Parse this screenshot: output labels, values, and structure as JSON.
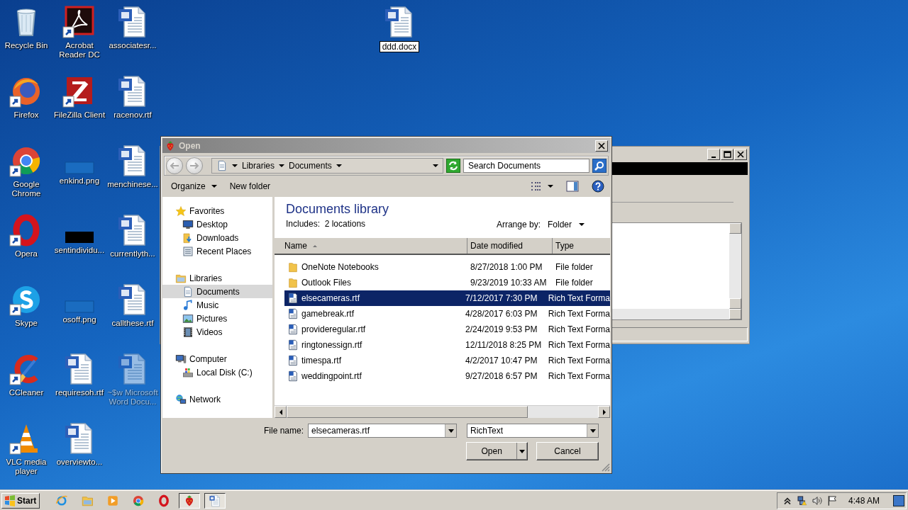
{
  "desktop": {
    "icons": [
      {
        "label": "Recycle Bin",
        "kind": "recycle",
        "shortcut": false
      },
      {
        "label": "Firefox",
        "kind": "firefox",
        "shortcut": true
      },
      {
        "label": "Google Chrome",
        "kind": "chrome",
        "shortcut": true
      },
      {
        "label": "Opera",
        "kind": "opera",
        "shortcut": true
      },
      {
        "label": "Skype",
        "kind": "skype",
        "shortcut": true
      },
      {
        "label": "CCleaner",
        "kind": "ccleaner",
        "shortcut": true
      },
      {
        "label": "VLC media player",
        "kind": "vlc",
        "shortcut": true
      },
      {
        "label": "Acrobat Reader DC",
        "kind": "acrobat",
        "shortcut": true
      },
      {
        "label": "FileZilla Client",
        "kind": "filezilla",
        "shortcut": true
      },
      {
        "label": "enkind.png",
        "kind": "image-blank",
        "shortcut": false
      },
      {
        "label": "sentindividu...",
        "kind": "image-black",
        "shortcut": false
      },
      {
        "label": "osoff.png",
        "kind": "image-blank",
        "shortcut": false
      },
      {
        "label": "requiresoh.rtf",
        "kind": "word",
        "shortcut": false
      },
      {
        "label": "overviewto...",
        "kind": "word",
        "shortcut": false
      },
      {
        "label": "associatesr...",
        "kind": "word",
        "shortcut": false
      },
      {
        "label": "racenov.rtf",
        "kind": "word",
        "shortcut": false
      },
      {
        "label": "menchinese...",
        "kind": "word",
        "shortcut": false
      },
      {
        "label": "currentlyth...",
        "kind": "word",
        "shortcut": false
      },
      {
        "label": "callthese.rtf",
        "kind": "word",
        "shortcut": false
      },
      {
        "label": "~$w Microsoft Word Docu...",
        "kind": "word-faded",
        "shortcut": false
      }
    ],
    "renaming_file": {
      "label": "ddd.docx",
      "kind": "word"
    }
  },
  "open_dialog": {
    "title": "Open",
    "address": {
      "crumbs": [
        "Libraries",
        "Documents"
      ]
    },
    "search": {
      "placeholder": "Search Documents"
    },
    "toolbar": {
      "organize": "Organize",
      "new_folder": "New folder"
    },
    "nav": [
      {
        "label": "Favorites",
        "kind": "star",
        "selected": false,
        "children": [
          {
            "label": "Desktop",
            "kind": "desktop",
            "selected": false
          },
          {
            "label": "Downloads",
            "kind": "downloads",
            "selected": false
          },
          {
            "label": "Recent Places",
            "kind": "recent",
            "selected": false
          }
        ]
      },
      {
        "label": "Libraries",
        "kind": "libraries",
        "selected": false,
        "children": [
          {
            "label": "Documents",
            "kind": "documents",
            "selected": true
          },
          {
            "label": "Music",
            "kind": "music",
            "selected": false
          },
          {
            "label": "Pictures",
            "kind": "pictures",
            "selected": false
          },
          {
            "label": "Videos",
            "kind": "videos",
            "selected": false
          }
        ]
      },
      {
        "label": "Computer",
        "kind": "computer",
        "selected": false,
        "children": [
          {
            "label": "Local Disk (C:)",
            "kind": "disk",
            "selected": false
          }
        ]
      },
      {
        "label": "Network",
        "kind": "network",
        "selected": false
      }
    ],
    "library": {
      "title": "Documents library",
      "includes": "Includes:  2 locations",
      "arrange_label": "Arrange by:",
      "arrange_value": "Folder"
    },
    "columns": [
      {
        "label": "Name",
        "sorted": true
      },
      {
        "label": "Date modified",
        "sorted": false
      },
      {
        "label": "Type",
        "sorted": false
      }
    ],
    "rows": [
      {
        "name": "OneNote Notebooks",
        "date": "8/27/2018 1:00 PM",
        "type": "File folder",
        "kind": "folder",
        "selected": false
      },
      {
        "name": "Outlook Files",
        "date": "9/23/2019 10:33 AM",
        "type": "File folder",
        "kind": "folder",
        "selected": false
      },
      {
        "name": "elsecameras.rtf",
        "date": "7/12/2017 7:30 PM",
        "type": "Rich Text Forma",
        "kind": "rtf",
        "selected": true
      },
      {
        "name": "gamebreak.rtf",
        "date": "4/28/2017 6:03 PM",
        "type": "Rich Text Forma",
        "kind": "rtf",
        "selected": false
      },
      {
        "name": "provideregular.rtf",
        "date": "2/24/2019 9:53 PM",
        "type": "Rich Text Forma",
        "kind": "rtf",
        "selected": false
      },
      {
        "name": "ringtonessign.rtf",
        "date": "12/11/2018 8:25 PM",
        "type": "Rich Text Forma",
        "kind": "rtf",
        "selected": false
      },
      {
        "name": "timespa.rtf",
        "date": "4/2/2017 10:47 PM",
        "type": "Rich Text Forma",
        "kind": "rtf",
        "selected": false
      },
      {
        "name": "weddingpoint.rtf",
        "date": "9/27/2018 6:57 PM",
        "type": "Rich Text Forma",
        "kind": "rtf",
        "selected": false
      }
    ],
    "file_name": {
      "label": "File name:",
      "value": "elsecameras.rtf"
    },
    "file_type": {
      "value": "RichText"
    },
    "buttons": [
      {
        "label": "Open",
        "kind": "split"
      },
      {
        "label": "Cancel",
        "kind": "plain"
      }
    ]
  },
  "taskbar": {
    "start": "Start",
    "apps": [
      {
        "kind": "ie",
        "pressed": false
      },
      {
        "kind": "explorer",
        "pressed": false
      },
      {
        "kind": "mediaplayer",
        "pressed": false
      },
      {
        "kind": "chrome",
        "pressed": false
      },
      {
        "kind": "opera",
        "pressed": false
      },
      {
        "kind": "fruit",
        "pressed": true
      },
      {
        "kind": "word",
        "pressed": true
      }
    ],
    "clock": "4:48 AM"
  }
}
